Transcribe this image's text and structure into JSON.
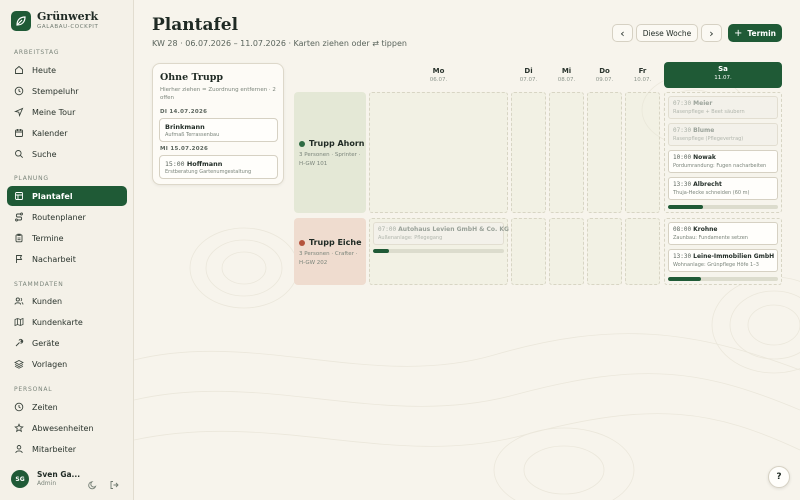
{
  "brand": {
    "title": "Grünwerk",
    "subtitle": "GALABAU-COCKPIT"
  },
  "sidebar": {
    "sections": [
      {
        "label": "ARBEITSTAG",
        "items": [
          {
            "label": "Heute",
            "icon": "home-icon"
          },
          {
            "label": "Stempeluhr",
            "icon": "clock-icon"
          },
          {
            "label": "Meine Tour",
            "icon": "navigation-icon"
          },
          {
            "label": "Kalender",
            "icon": "calendar-icon"
          },
          {
            "label": "Suche",
            "icon": "search-icon"
          }
        ]
      },
      {
        "label": "PLANUNG",
        "items": [
          {
            "label": "Plantafel",
            "icon": "grid-icon",
            "active": true
          },
          {
            "label": "Routenplaner",
            "icon": "route-icon"
          },
          {
            "label": "Termine",
            "icon": "clipboard-icon"
          },
          {
            "label": "Nacharbeit",
            "icon": "flag-icon"
          }
        ]
      },
      {
        "label": "STAMMDATEN",
        "items": [
          {
            "label": "Kunden",
            "icon": "users-icon"
          },
          {
            "label": "Kundenkarte",
            "icon": "map-icon"
          },
          {
            "label": "Geräte",
            "icon": "tool-icon"
          },
          {
            "label": "Vorlagen",
            "icon": "layers-icon"
          }
        ]
      },
      {
        "label": "PERSONAL",
        "items": [
          {
            "label": "Zeiten",
            "icon": "clock-icon"
          },
          {
            "label": "Abwesenheiten",
            "icon": "star-icon"
          },
          {
            "label": "Mitarbeiter",
            "icon": "user-icon"
          }
        ]
      }
    ]
  },
  "user": {
    "initials": "SG",
    "name": "Sven Ga...",
    "role": "Admin"
  },
  "header": {
    "title": "Plantafel",
    "subtitle": "KW 28 · 06.07.2026 – 11.07.2026 · Karten ziehen oder ⇄ tippen",
    "prev_label": "‹",
    "week_label": "Diese Woche",
    "next_label": "›",
    "new_label": "Termin"
  },
  "pool": {
    "title": "Ohne Trupp",
    "hint": "Hierher ziehen = Zuordnung entfernen · 2 offen",
    "groups": [
      {
        "day": "DI 14.07.2026",
        "jobs": [
          {
            "time": "",
            "name": "Brinkmann",
            "desc": "Aufmaß Terrassenbau"
          }
        ]
      },
      {
        "day": "MI 15.07.2026",
        "jobs": [
          {
            "time": "15:00",
            "name": "Hoffmann",
            "desc": "Erstberatung Gartenumgestaltung"
          }
        ]
      }
    ]
  },
  "days": [
    {
      "name": "Mo",
      "date": "06.07."
    },
    {
      "name": "Di",
      "date": "07.07."
    },
    {
      "name": "Mi",
      "date": "08.07."
    },
    {
      "name": "Do",
      "date": "09.07."
    },
    {
      "name": "Fr",
      "date": "10.07."
    },
    {
      "name": "Sa",
      "date": "11.07.",
      "today": true
    }
  ],
  "crews": [
    {
      "name": "Trupp Ahorn",
      "meta": "3 Personen · Sprinter · H-GW 101",
      "color": "#2e6b43",
      "bg": "#e4e8d6"
    },
    {
      "name": "Trupp Eiche",
      "meta": "3 Personen · Crafter · H-GW 202",
      "color": "#b4533c",
      "bg": "#efdccf"
    }
  ],
  "jobs": {
    "ahorn_sa": [
      {
        "time": "07:30",
        "name": "Meier",
        "desc": "Rasenpflege + Beet säubern",
        "ghost": true
      },
      {
        "time": "07:30",
        "name": "Blume",
        "desc": "Rasenpflege (Pflegevertrag)",
        "ghost": true
      },
      {
        "time": "10:00",
        "name": "Nowak",
        "desc": "Pordumrandung: Fugen nacharbeiten",
        "ghost": false
      },
      {
        "time": "13:30",
        "name": "Albrecht",
        "desc": "Thuja-Hecke schneiden (60 m)",
        "ghost": false
      }
    ],
    "ahorn_sa_progress": 0.32,
    "eiche_mo": [
      {
        "time": "07:00",
        "name": "Autohaus Levien GmbH & Co. KG",
        "desc": "Außenanlage: Pflegegang",
        "ghost": true
      }
    ],
    "eiche_mo_progress": 0.12,
    "eiche_sa": [
      {
        "time": "08:00",
        "name": "Krohne",
        "desc": "Zaunbau: Fundamente setzen",
        "ghost": false
      },
      {
        "time": "13:30",
        "name": "Leine-Immobilien GmbH",
        "desc": "Wohnanlage: Grünpflege Höfe 1–3",
        "ghost": false
      }
    ],
    "eiche_sa_progress": 0.3
  },
  "help_label": "?",
  "colors": {
    "accent": "#1f5a36",
    "eiche": "#b4533c"
  }
}
